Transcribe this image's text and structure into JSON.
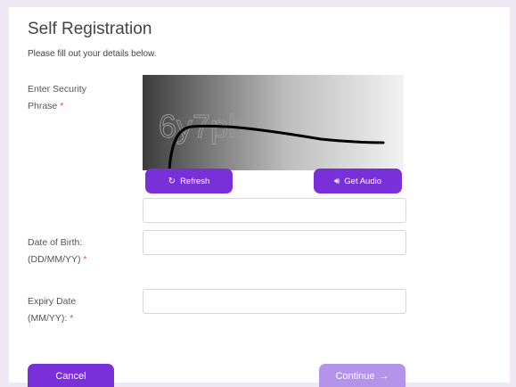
{
  "form": {
    "title": "Self Registration",
    "subtitle": "Please fill out your details below."
  },
  "security": {
    "label_line1": "Enter Security",
    "label_line2": "Phrase",
    "required_mark": "*",
    "captcha_text": "6y7ph",
    "refresh_icon": "refresh-icon",
    "refresh_label": "Refresh",
    "audio_icon": "speaker-icon",
    "audio_label": "Get Audio",
    "input_value": ""
  },
  "dob": {
    "label_line1": "Date of Birth:",
    "label_line2": "(DD/MM/YY)",
    "required_mark": "*",
    "value": ""
  },
  "expiry": {
    "label_line1": "Expiry Date",
    "label_line2": "(MM/YY):",
    "required_mark": "*",
    "value": ""
  },
  "actions": {
    "cancel_label": "Cancel",
    "continue_label": "Continue",
    "continue_icon": "arrow-right-icon"
  },
  "colors": {
    "accent": "#7a30d9",
    "accent_disabled": "#b394e8",
    "background": "#efe9f6",
    "required": "#d9534f"
  }
}
